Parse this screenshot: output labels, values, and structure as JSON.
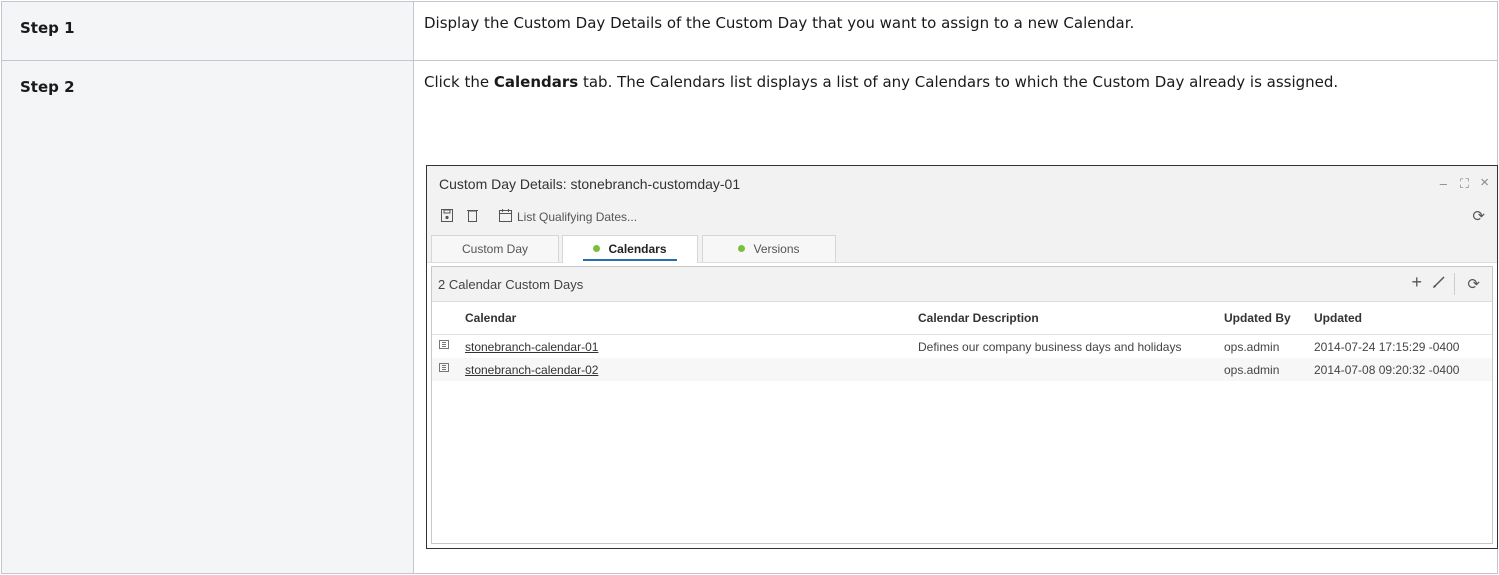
{
  "steps": [
    {
      "label": "Step 1",
      "text": "Display the Custom Day Details of the Custom Day that you want to assign to a new Calendar."
    },
    {
      "label": "Step 2",
      "text_pre": "Click the ",
      "text_bold": "Calendars",
      "text_post": " tab. The Calendars list displays a list of any Calendars to which the Custom Day already is assigned."
    }
  ],
  "window": {
    "title": "Custom Day Details: stonebranch-customday-01",
    "controls": {
      "minimize": "–",
      "maximize": "⛶",
      "close": "×"
    },
    "toolbar": {
      "list_dates_label": "List Qualifying Dates..."
    },
    "tabs": [
      {
        "label": "Custom Day",
        "active": false,
        "dot": false
      },
      {
        "label": "Calendars",
        "active": true,
        "dot": true
      },
      {
        "label": "Versions",
        "active": false,
        "dot": true
      }
    ],
    "panel": {
      "count_label": "2 Calendar Custom Days",
      "columns": [
        "Calendar",
        "Calendar Description",
        "Updated By",
        "Updated"
      ],
      "rows": [
        {
          "calendar": "stonebranch-calendar-01",
          "description": "Defines our company business days and holidays",
          "updated_by": "ops.admin",
          "updated": "2014-07-24 17:15:29 -0400"
        },
        {
          "calendar": "stonebranch-calendar-02",
          "description": "",
          "updated_by": "ops.admin",
          "updated": "2014-07-08 09:20:32 -0400"
        }
      ]
    }
  }
}
